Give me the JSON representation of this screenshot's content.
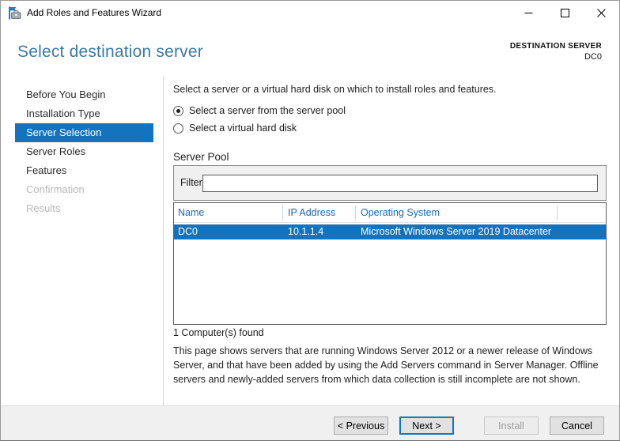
{
  "window": {
    "title": "Add Roles and Features Wizard"
  },
  "header": {
    "title": "Select destination server",
    "destination_label": "DESTINATION SERVER",
    "destination_value": "DC0"
  },
  "sidebar": {
    "items": [
      {
        "label": "Before You Begin",
        "state": "normal"
      },
      {
        "label": "Installation Type",
        "state": "normal"
      },
      {
        "label": "Server Selection",
        "state": "selected"
      },
      {
        "label": "Server Roles",
        "state": "normal"
      },
      {
        "label": "Features",
        "state": "normal"
      },
      {
        "label": "Confirmation",
        "state": "disabled"
      },
      {
        "label": "Results",
        "state": "disabled"
      }
    ]
  },
  "main": {
    "intro": "Select a server or a virtual hard disk on which to install roles and features.",
    "radio_options": [
      {
        "label": "Select a server from the server pool",
        "selected": true
      },
      {
        "label": "Select a virtual hard disk",
        "selected": false
      }
    ],
    "server_pool": {
      "title": "Server Pool",
      "filter_label": "Filter:",
      "filter_value": "",
      "table": {
        "columns": [
          "Name",
          "IP Address",
          "Operating System"
        ],
        "rows": [
          {
            "name": "DC0",
            "ip": "10.1.1.4",
            "os": "Microsoft Windows Server 2019 Datacenter",
            "selected": true
          }
        ]
      },
      "count_text": "1 Computer(s) found"
    },
    "description": "This page shows servers that are running Windows Server 2012 or a newer release of Windows Server, and that have been added by using the Add Servers command in Server Manager. Offline servers and newly-added servers from which data collection is still incomplete are not shown."
  },
  "footer": {
    "buttons": [
      {
        "label": "< Previous",
        "state": "normal"
      },
      {
        "label": "Next >",
        "state": "default"
      },
      {
        "label": "Install",
        "state": "disabled"
      },
      {
        "label": "Cancel",
        "state": "normal"
      }
    ]
  },
  "colors": {
    "accent_blue": "#1473be",
    "title_blue": "#3b78ab",
    "header_text_blue": "#1a68b8",
    "default_button_border": "#0078d7",
    "footer_bg": "#f0f0f0"
  }
}
